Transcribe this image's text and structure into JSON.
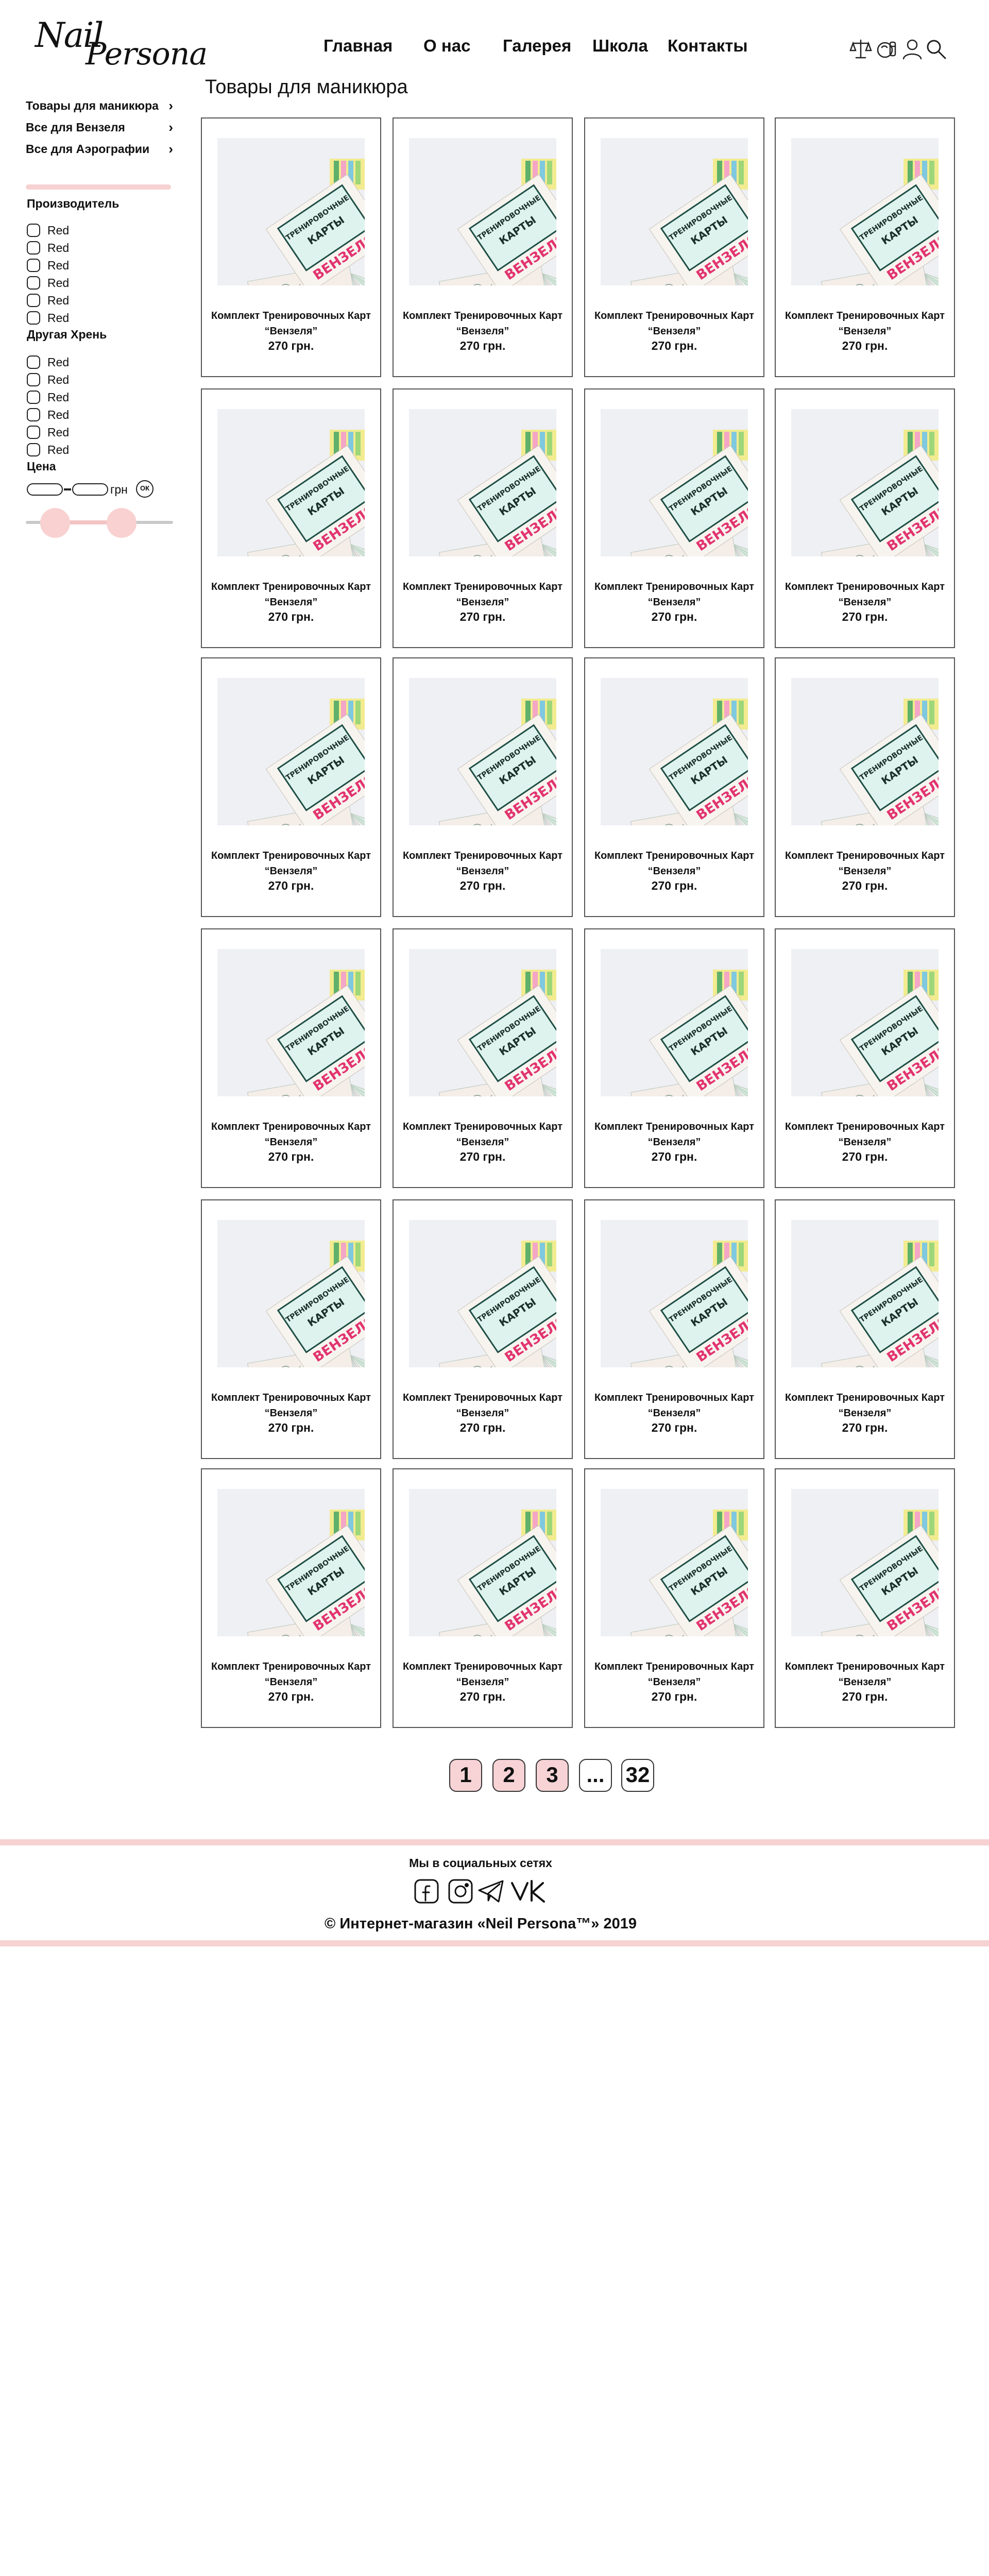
{
  "header": {
    "logo_line1": "Nail",
    "logo_line2": "Persona",
    "nav": [
      "Главная",
      "О нас",
      "Галерея",
      "Школа",
      "Контакты"
    ],
    "icons": [
      "scales-icon",
      "cosmetics-icon",
      "user-icon",
      "search-icon"
    ]
  },
  "sidebar": {
    "categories": [
      "Товары для маникюра",
      "Все для Вензеля",
      "Все для Аэрографии"
    ],
    "filters": [
      {
        "title": "Производитель",
        "options": [
          "Red",
          "Red",
          "Red",
          "Red",
          "Red",
          "Red"
        ]
      },
      {
        "title": "Другая Хрень",
        "options": [
          "Red",
          "Red",
          "Red",
          "Red",
          "Red",
          "Red"
        ]
      }
    ],
    "price": {
      "title": "Цена",
      "unit": "грн",
      "min_value": "",
      "max_value": "",
      "ok_label": "ОК",
      "slider_low": 0.2,
      "slider_high": 0.65
    }
  },
  "main": {
    "title": "Товары для маникюра",
    "products": [
      {
        "name": "Комплект Тренировочных Карт “Вензеля”",
        "price": "270 грн."
      },
      {
        "name": "Комплект Тренировочных Карт “Вензеля”",
        "price": "270 грн."
      },
      {
        "name": "Комплект Тренировочных Карт “Вензеля”",
        "price": "270 грн."
      },
      {
        "name": "Комплект Тренировочных Карт “Вензеля”",
        "price": "270 грн."
      },
      {
        "name": "Комплект Тренировочных Карт “Вензеля”",
        "price": "270 грн."
      },
      {
        "name": "Комплект Тренировочных Карт “Вензеля”",
        "price": "270 грн."
      },
      {
        "name": "Комплект Тренировочных Карт “Вензеля”",
        "price": "270 грн."
      },
      {
        "name": "Комплект Тренировочных Карт “Вензеля”",
        "price": "270 грн."
      },
      {
        "name": "Комплект Тренировочных Карт “Вензеля”",
        "price": "270 грн."
      },
      {
        "name": "Комплект Тренировочных Карт “Вензеля”",
        "price": "270 грн."
      },
      {
        "name": "Комплект Тренировочных Карт “Вензеля”",
        "price": "270 грн."
      },
      {
        "name": "Комплект Тренировочных Карт “Вензеля”",
        "price": "270 грн."
      },
      {
        "name": "Комплект Тренировочных Карт “Вензеля”",
        "price": "270 грн."
      },
      {
        "name": "Комплект Тренировочных Карт “Вензеля”",
        "price": "270 грн."
      },
      {
        "name": "Комплект Тренировочных Карт “Вензеля”",
        "price": "270 грн."
      },
      {
        "name": "Комплект Тренировочных Карт “Вензеля”",
        "price": "270 грн."
      },
      {
        "name": "Комплект Тренировочных Карт “Вензеля”",
        "price": "270 грн."
      },
      {
        "name": "Комплект Тренировочных Карт “Вензеля”",
        "price": "270 грн."
      },
      {
        "name": "Комплект Тренировочных Карт “Вензеля”",
        "price": "270 грн."
      },
      {
        "name": "Комплект Тренировочных Карт “Вензеля”",
        "price": "270 грн."
      },
      {
        "name": "Комплект Тренировочных Карт “Вензеля”",
        "price": "270 грн."
      },
      {
        "name": "Комплект Тренировочных Карт “Вензеля”",
        "price": "270 грн."
      },
      {
        "name": "Комплект Тренировочных Карт “Вензеля”",
        "price": "270 грн."
      },
      {
        "name": "Комплект Тренировочных Карт “Вензеля”",
        "price": "270 грн."
      }
    ],
    "product_image_text": [
      "ТРЕНИРОВОЧНЫЕ",
      "КАРТЫ",
      "ВЕНЗЕЛЯ"
    ]
  },
  "pagination": {
    "pages": [
      {
        "label": "1",
        "style": "pink"
      },
      {
        "label": "2",
        "style": "pink"
      },
      {
        "label": "3",
        "style": "pink"
      },
      {
        "label": "...",
        "style": "white"
      },
      {
        "label": "32",
        "style": "white"
      }
    ]
  },
  "footer": {
    "social_title": "Мы в социальных сетях",
    "socials": [
      "facebook-icon",
      "instagram-icon",
      "telegram-icon",
      "vk-icon"
    ],
    "copyright": "© Интернет-магазин «Neil Persona™» 2019"
  },
  "colors": {
    "accent_pink": "#f6d2d2",
    "page_button_pink": "#f7d3d6",
    "card_border": "#555555",
    "product_label_pink": "#e2336f"
  }
}
